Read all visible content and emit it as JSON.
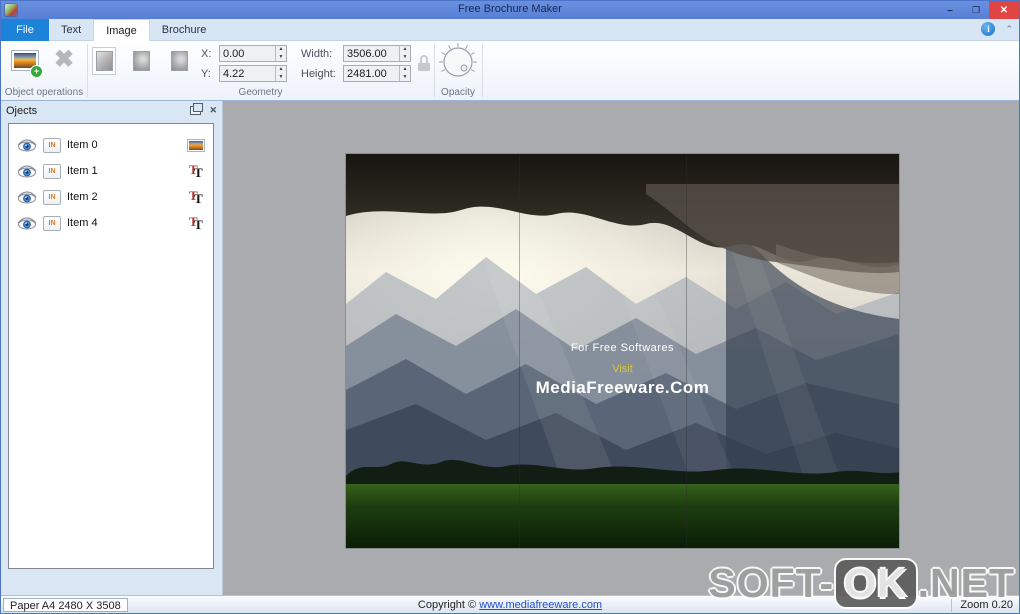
{
  "window": {
    "title": "Free Brochure Maker"
  },
  "tabs": {
    "file": "File",
    "text": "Text",
    "image": "Image",
    "brochure": "Brochure"
  },
  "ribbon": {
    "groups": {
      "object_operations": {
        "label": "Object operations"
      },
      "geometry": {
        "label": "Geometry",
        "x_label": "X:",
        "x_value": "0.00",
        "y_label": "Y:",
        "y_value": "4.22",
        "width_label": "Width:",
        "width_value": "3506.00",
        "height_label": "Height:",
        "height_value": "2481.00"
      },
      "opacity": {
        "label": "Opacity"
      }
    }
  },
  "objects_panel": {
    "title": "Ojects",
    "items": [
      {
        "label": "Item 0",
        "badge": "IN",
        "type": "image"
      },
      {
        "label": "Item 1",
        "badge": "IN",
        "type": "text"
      },
      {
        "label": "Item 2",
        "badge": "IN",
        "type": "text"
      },
      {
        "label": "Item 4",
        "badge": "IN",
        "type": "text"
      }
    ]
  },
  "canvas": {
    "overlay": {
      "line1": "For Free Softwares",
      "line2": "Visit",
      "line3": "MediaFreeware.Com"
    }
  },
  "status_bar": {
    "paper": "Paper A4 2480 X 3508",
    "copyright_prefix": "Copyright ©",
    "copyright_link": "www.mediafreeware.com",
    "zoom": "Zoom 0.20"
  },
  "watermark": {
    "left": "SOFT-",
    "mid": "OK",
    "right": ".NET"
  },
  "colors": {
    "titlebar": "#5b83d9",
    "file_tab": "#1d83d8",
    "close_button": "#e04543",
    "canvas_bg": "#a9abae",
    "link": "#1f4fc8",
    "visit_text": "#d8c24a"
  }
}
